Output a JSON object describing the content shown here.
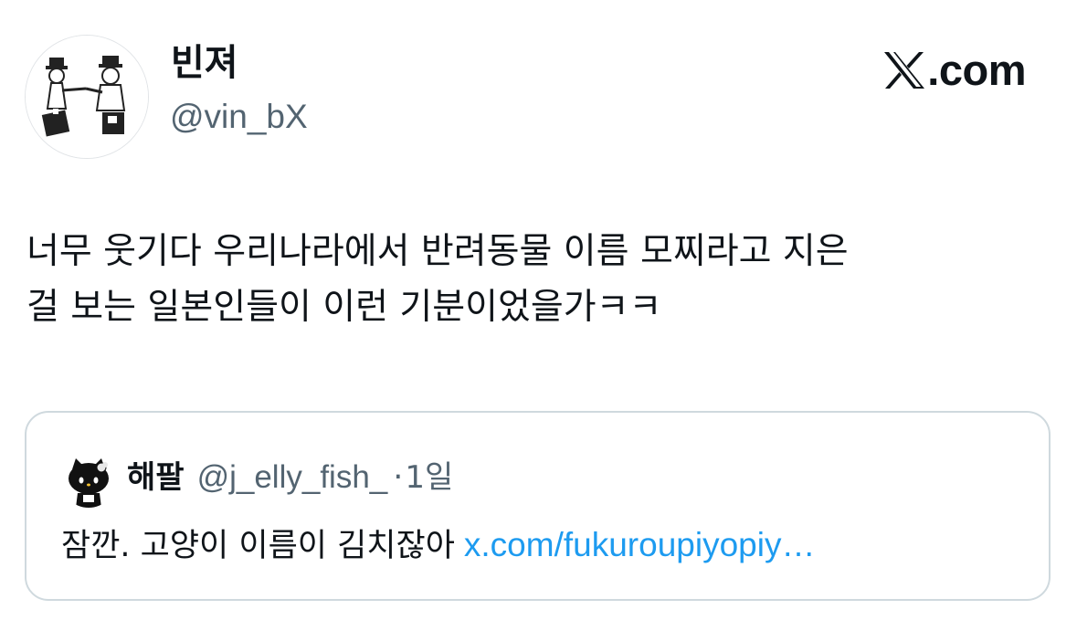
{
  "author": {
    "display_name": "빈져",
    "handle": "@vin_bX"
  },
  "brand": {
    "label": ".com",
    "icon": "x-logo-icon"
  },
  "tweet": {
    "lines": [
      "너무 웃기다 우리나라에서 반려동물 이름 모찌라고 지은",
      "걸 보는 일본인들이 이런 기분이었을가ㅋㅋ"
    ]
  },
  "quote": {
    "display_name": "해팔",
    "handle": "@j_elly_fish_",
    "separator": "·",
    "time": "1일",
    "text": "잠깐. 고양이 이름이 김치잖아",
    "link": "x.com/fukuroupiyopiy…"
  },
  "colors": {
    "text": "#0f1419",
    "secondary": "#536471",
    "link": "#1d9bf0",
    "border": "#cfd9de"
  }
}
